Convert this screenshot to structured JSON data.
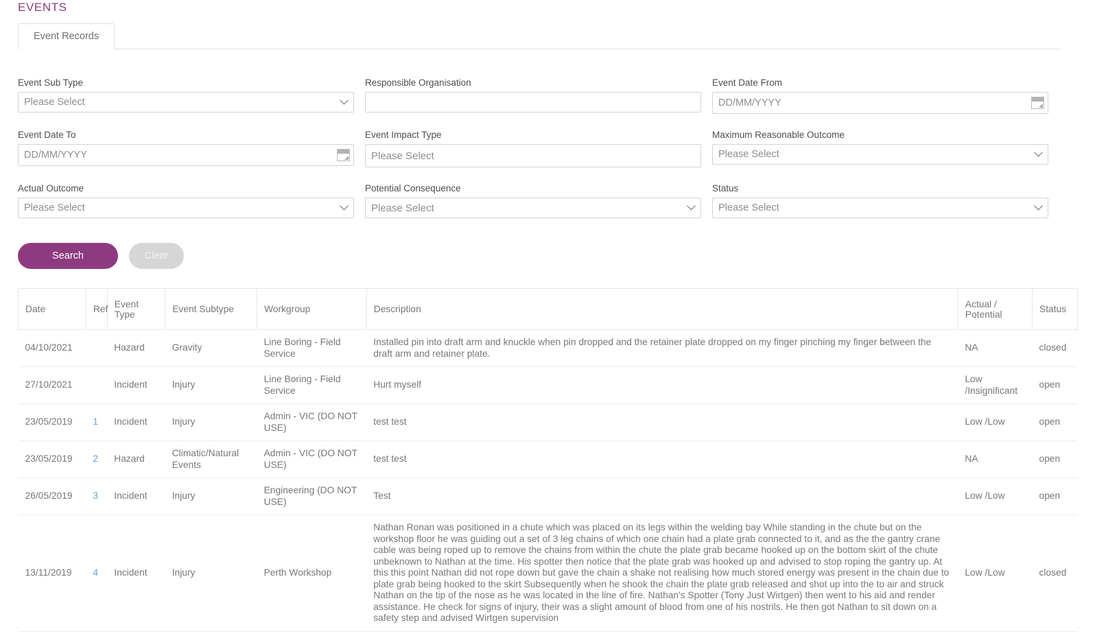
{
  "page": {
    "title": "EVENTS"
  },
  "tabs": [
    {
      "label": "Event Records",
      "active": true
    }
  ],
  "search_form": {
    "fields": [
      {
        "name": "event-sub-type",
        "label": "Event Sub Type",
        "kind": "select",
        "value": "Please Select"
      },
      {
        "name": "responsible-organisation",
        "label": "Responsible Organisation",
        "kind": "text",
        "value": ""
      },
      {
        "name": "event-date-from",
        "label": "Event Date From",
        "kind": "date",
        "value": "",
        "placeholder": "DD/MM/YYYY"
      },
      {
        "name": "event-date-to",
        "label": "Event Date To",
        "kind": "date",
        "value": "",
        "placeholder": "DD/MM/YYYY"
      },
      {
        "name": "event-impact-type",
        "label": "Event Impact Type",
        "kind": "select",
        "value": "Please Select"
      },
      {
        "name": "maximum-reasonable-outcome",
        "label": "Maximum Reasonable Outcome",
        "kind": "select",
        "value": "Please Select"
      },
      {
        "name": "actual-outcome",
        "label": "Actual Outcome",
        "kind": "select",
        "value": "Please Select"
      },
      {
        "name": "potential-consequence",
        "label": "Potential Consequence",
        "kind": "select",
        "value": "Please Select"
      },
      {
        "name": "status",
        "label": "Status",
        "kind": "select",
        "value": "Please Select"
      }
    ],
    "buttons": {
      "search_label": "Search",
      "clear_label": "Clear"
    },
    "icons": {
      "date_picker": "calendar-icon",
      "select_arrow": "chevron-down-icon"
    }
  },
  "results_table": {
    "columns": [
      "Date",
      "Ref",
      "Event Type",
      "Event Subtype",
      "Workgroup",
      "Description",
      "Actual / Potential",
      "Status"
    ],
    "rows": [
      {
        "date": "04/10/2021",
        "ref": "",
        "event_type": "Hazard",
        "event_subtype": "Gravity",
        "workgroup": "Line Boring - Field Service",
        "description": "Installed pin into draft arm and knuckle when pin dropped and the retainer plate dropped on my finger pinching my finger between the draft arm and retainer plate.",
        "actual_potential": "NA",
        "status": "closed"
      },
      {
        "date": "27/10/2021",
        "ref": "",
        "event_type": "Incident",
        "event_subtype": "Injury",
        "workgroup": "Line Boring - Field Service",
        "description": "Hurt myself",
        "actual_potential": "Low /Insignificant",
        "status": "open"
      },
      {
        "date": "23/05/2019",
        "ref": "1",
        "event_type": "Incident",
        "event_subtype": "Injury",
        "workgroup": "Admin - VIC (DO NOT USE)",
        "description": "test test",
        "actual_potential": "Low /Low",
        "status": "open"
      },
      {
        "date": "23/05/2019",
        "ref": "2",
        "event_type": "Hazard",
        "event_subtype": "Climatic/Natural Events",
        "workgroup": "Admin - VIC (DO NOT USE)",
        "description": "test test",
        "actual_potential": "NA",
        "status": "open"
      },
      {
        "date": "26/05/2019",
        "ref": "3",
        "event_type": "Incident",
        "event_subtype": "Injury",
        "workgroup": "Engineering (DO NOT USE)",
        "description": "Test",
        "actual_potential": "Low /Low",
        "status": "open"
      },
      {
        "date": "13/11/2019",
        "ref": "4",
        "event_type": "Incident",
        "event_subtype": "Injury",
        "workgroup": "Perth Workshop",
        "description": "Nathan Ronan was positioned in a chute which was placed on its legs within the welding bay While standing in the chute but on the workshop floor he was guiding out a set of 3 leg chains of which one chain had a plate grab connected to it, and as the the gantry crane cable was being roped up to remove the chains from within the chute the plate grab became hooked up on the bottom skirt of the chute unbeknown to Nathan at the time. His spotter then notice that the plate grab was hooked up and advised to stop roping the gantry up. At this this point Nathan did not rope down but gave the chain a shake not realising how much stored energy was present in the chain due to plate grab being hooked to the skirt Subsequently when he shook the chain the plate grab released and shot up into the to air and struck Nathan on the tip of the nose as he was located in the line of fire. Nathan's Spotter (Tony Just Wirtgen) then went to his aid and render assistance. He check for signs of injury, their was a slight amount of blood from one of his nostrils. He then got Nathan to sit down on a safety step and advised Wirtgen supervision",
        "actual_potential": "Low /Low",
        "status": "closed"
      }
    ]
  },
  "colors": {
    "accent": "#8e3a80",
    "link": "#64a0d8",
    "text": "#77777d",
    "border": "#e7e7e8"
  }
}
